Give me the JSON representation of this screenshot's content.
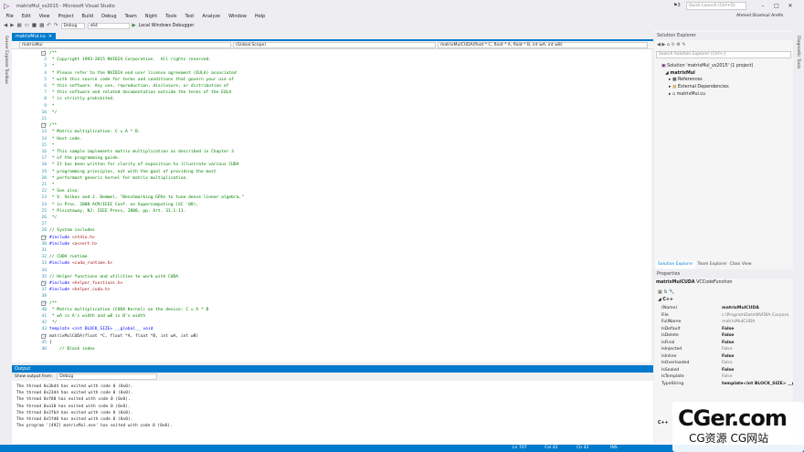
{
  "window": {
    "title": "matrixMul_vs2015 - Microsoft Visual Studio",
    "quick_launch": "Quick Launch (Ctrl+Q)",
    "notifications": "3"
  },
  "menu": [
    "File",
    "Edit",
    "View",
    "Project",
    "Build",
    "Debug",
    "Team",
    "Night",
    "Tools",
    "Test",
    "Analyze",
    "Window",
    "Help"
  ],
  "user": "Ahmed Shamsul Arefin",
  "toolbar": {
    "config": "Debug",
    "platform": "x64",
    "run_label": "Local Windows Debugger"
  },
  "left_strip": [
    "Server Explorer",
    "Toolbox"
  ],
  "right_strip": [
    "Diagnostic Tools"
  ],
  "editor": {
    "tab": "matrixMul.cu",
    "nav": [
      "matrixMul",
      "(Global Scope)",
      "matrixMulCUDA(float * C, float * A, float * B, int wA, int wB)"
    ],
    "lines": [
      {
        "n": "1",
        "t": "/**",
        "c": "cm",
        "f": "-"
      },
      {
        "n": "2",
        "t": " * Copyright 1993-2015 NVIDIA Corporation.  All rights reserved.",
        "c": "cm"
      },
      {
        "n": "3",
        "t": " *",
        "c": "cm"
      },
      {
        "n": "4",
        "t": " * Please refer to the NVIDIA end user license agreement (EULA) associated",
        "c": "cm"
      },
      {
        "n": "5",
        "t": " * with this source code for terms and conditions that govern your use of",
        "c": "cm"
      },
      {
        "n": "6",
        "t": " * this software. Any use, reproduction, disclosure, or distribution of",
        "c": "cm"
      },
      {
        "n": "7",
        "t": " * this software and related documentation outside the terms of the EULA",
        "c": "cm"
      },
      {
        "n": "8",
        "t": " * is strictly prohibited.",
        "c": "cm"
      },
      {
        "n": "9",
        "t": " *",
        "c": "cm"
      },
      {
        "n": "10",
        "t": " */",
        "c": "cm"
      },
      {
        "n": "11",
        "t": "",
        "c": "cm"
      },
      {
        "n": "12",
        "t": "/**",
        "c": "cm",
        "f": "-"
      },
      {
        "n": "13",
        "t": " * Matrix multiplication: C = A * B.",
        "c": "cm"
      },
      {
        "n": "14",
        "t": " * Host code.",
        "c": "cm"
      },
      {
        "n": "15",
        "t": " *",
        "c": "cm"
      },
      {
        "n": "16",
        "t": " * This sample implements matrix multiplication as described in Chapter 3",
        "c": "cm"
      },
      {
        "n": "17",
        "t": " * of the programming guide.",
        "c": "cm"
      },
      {
        "n": "18",
        "t": " * It has been written for clarity of exposition to illustrate various CUDA",
        "c": "cm"
      },
      {
        "n": "19",
        "t": " * programming principles, not with the goal of providing the most",
        "c": "cm"
      },
      {
        "n": "20",
        "t": " * performant generic kernel for matrix multiplication.",
        "c": "cm"
      },
      {
        "n": "21",
        "t": " *",
        "c": "cm"
      },
      {
        "n": "22",
        "t": " * See also:",
        "c": "cm"
      },
      {
        "n": "23",
        "t": " * V. Volkov and J. Demmel, \"Benchmarking GPUs to tune dense linear algebra,\"",
        "c": "cm"
      },
      {
        "n": "24",
        "t": " * in Proc. 2008 ACM/IEEE Conf. on Supercomputing (SC '08),",
        "c": "cm"
      },
      {
        "n": "25",
        "t": " * Piscataway, NJ: IEEE Press, 2008, pp. Art. 31:1-11.",
        "c": "cm"
      },
      {
        "n": "26",
        "t": " */",
        "c": "cm"
      },
      {
        "n": "27",
        "t": "",
        "c": "cm"
      },
      {
        "n": "28",
        "t": "// System includes",
        "c": "cm"
      },
      {
        "n": "29",
        "t": "#include <stdio.h>",
        "c": "inc",
        "f": "-"
      },
      {
        "n": "30",
        "t": "#include <assert.h>",
        "c": "inc"
      },
      {
        "n": "31",
        "t": "",
        "c": "cm"
      },
      {
        "n": "32",
        "t": "// CUDA runtime",
        "c": "cm"
      },
      {
        "n": "33",
        "t": "#include <cuda_runtime.h>",
        "c": "inc"
      },
      {
        "n": "34",
        "t": "",
        "c": "cm"
      },
      {
        "n": "35",
        "t": "// Helper functions and utilities to work with CUDA",
        "c": "cm"
      },
      {
        "n": "36",
        "t": "#include <helper_functions.h>",
        "c": "inc",
        "f": "-"
      },
      {
        "n": "37",
        "t": "#include <helper_cuda.h>",
        "c": "inc"
      },
      {
        "n": "38",
        "t": "",
        "c": "cm"
      },
      {
        "n": "39",
        "t": "/**",
        "c": "cm",
        "f": "-"
      },
      {
        "n": "40",
        "t": " * Matrix multiplication (CUDA Kernel) on the device: C = A * B",
        "c": "cm"
      },
      {
        "n": "41",
        "t": " * wA is A's width and wB is B's width",
        "c": "cm"
      },
      {
        "n": "42",
        "t": " */",
        "c": "cm"
      },
      {
        "n": "43",
        "t": "template <int BLOCK_SIZE> __global__ void",
        "c": "kw"
      },
      {
        "n": "44",
        "t": "matrixMulCUDA(float *C, float *A, float *B, int wA, int wB)",
        "c": "code",
        "f": "-"
      },
      {
        "n": "45",
        "t": "{",
        "c": "code"
      },
      {
        "n": "46",
        "t": "    // Block index",
        "c": "cm"
      }
    ]
  },
  "output": {
    "title": "Output",
    "show_label": "Show output from:",
    "source": "Debug",
    "lines": [
      "The thread 0x3bd4 has exited with code 0 (0x0).",
      "The thread 0x23d4 has exited with code 0 (0x0).",
      "The thread 0xf80 has exited with code 0 (0x0).",
      "The thread 0xa18 has exited with code 0 (0x0).",
      "The thread 0x2fb4 has exited with code 0 (0x0).",
      "The thread 0x5fd0 has exited with code 0 (0x0).",
      "The program '[492] matrixMul.exe' has exited with code 0 (0x0)."
    ]
  },
  "solution_explorer": {
    "title": "Solution Explorer",
    "search": "Search Solution Explorer (Ctrl+;)",
    "items": [
      "Solution 'matrixMul_vs2015' (1 project)",
      "matrixMul",
      "References",
      "External Dependencies",
      "matrixMul.cu"
    ],
    "tabs": [
      "Solution Explorer",
      "Team Explorer",
      "Class View"
    ]
  },
  "properties": {
    "title": "Properties",
    "object": "matrixMulCUDA",
    "object_type": "VCCodeFunction",
    "category": "C++",
    "rows": [
      {
        "n": "(Name)",
        "v": "matrixMulCUDA",
        "b": true
      },
      {
        "n": "File",
        "v": "c:\\ProgramData\\NVIDIA Corpora",
        "b": false
      },
      {
        "n": "FullName",
        "v": "matrixMulCUDA",
        "b": false
      },
      {
        "n": "IsDefault",
        "v": "False",
        "b": true
      },
      {
        "n": "IsDelete",
        "v": "False",
        "b": true
      },
      {
        "n": "IsFinal",
        "v": "False",
        "b": true
      },
      {
        "n": "IsInjected",
        "v": "False",
        "b": false
      },
      {
        "n": "IsInline",
        "v": "False",
        "b": true
      },
      {
        "n": "IsOverloaded",
        "v": "False",
        "b": false
      },
      {
        "n": "IsSealed",
        "v": "False",
        "b": true
      },
      {
        "n": "IsTemplate",
        "v": "False",
        "b": false
      },
      {
        "n": "TypeString",
        "v": "template<int BLOCK_SIZE> __gl",
        "b": true
      }
    ],
    "footer": "C++"
  },
  "status": {
    "ln": "Ln 707",
    "col": "Col 42",
    "ch": "Ch 42",
    "mode": "INS"
  },
  "watermark": {
    "big": "CGer.com",
    "small": "CG资源 CG网站"
  },
  "colors": {
    "accent": "#007acc",
    "comment": "#008000",
    "keyword": "#0000ff",
    "string": "#a31515",
    "linenumber": "#2b91af"
  }
}
